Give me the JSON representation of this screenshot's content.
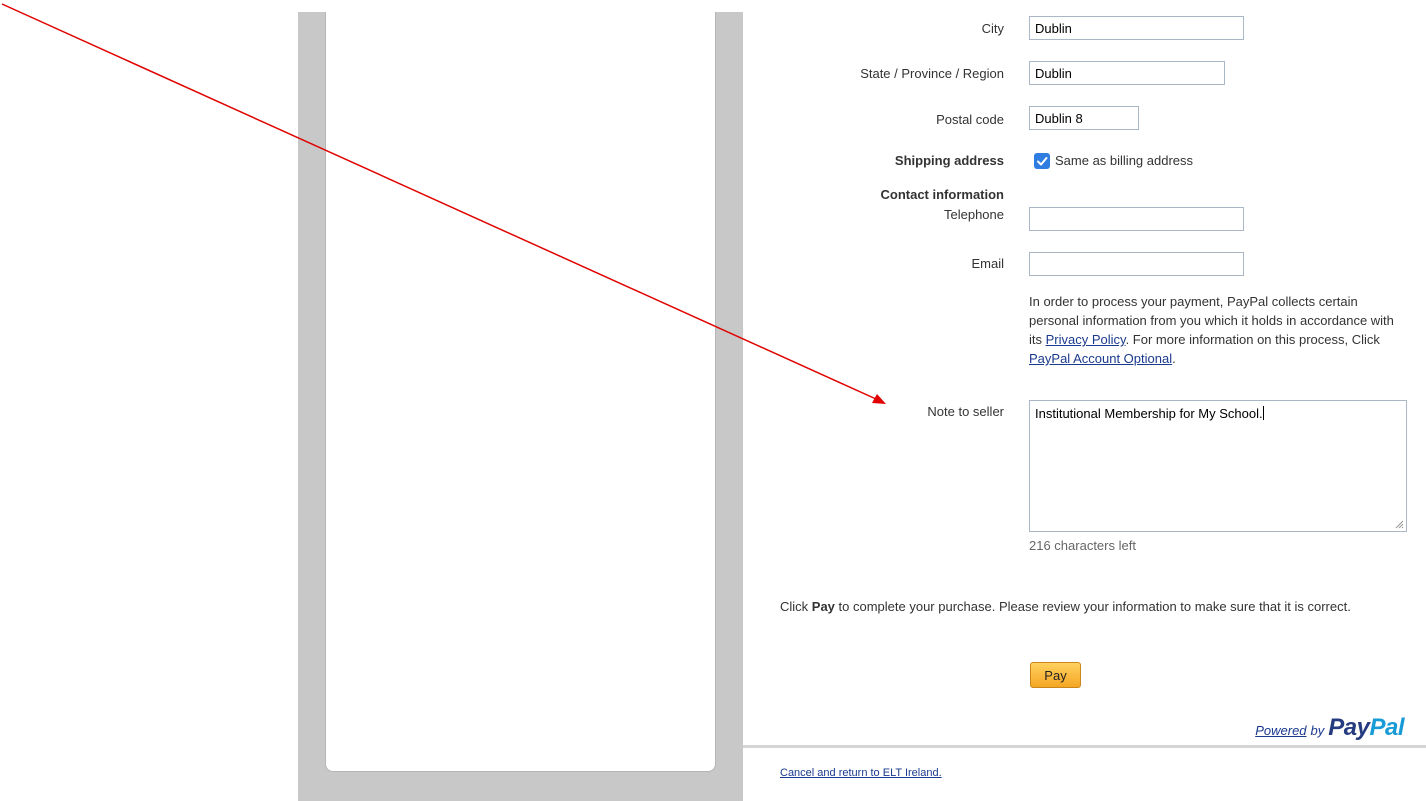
{
  "form": {
    "city": {
      "label": "City",
      "value": "Dublin"
    },
    "state": {
      "label": "State / Province / Region",
      "value": "Dublin"
    },
    "postal": {
      "label": "Postal code",
      "value": "Dublin 8"
    },
    "shipping": {
      "label": "Shipping address",
      "checkbox_label": "Same as billing address",
      "checked": true
    },
    "contact": {
      "heading": "Contact information",
      "telephone_label": "Telephone",
      "telephone_value": "",
      "email_label": "Email",
      "email_value": ""
    },
    "privacy": {
      "text_before": "In order to process your payment, PayPal collects certain personal information from you which it holds in accordance with its ",
      "privacy_link": "Privacy Policy",
      "text_middle": ". For more information on this process, Click ",
      "account_link": "PayPal Account Optional",
      "text_after": "."
    },
    "note": {
      "label": "Note to seller",
      "value": "Institutional Membership for My School.",
      "chars_left": "216 characters left"
    }
  },
  "pay_instruction": {
    "before": "Click ",
    "bold": "Pay",
    "after": " to complete your purchase. Please review your information to make sure that it is correct."
  },
  "pay_button": "Pay",
  "powered": {
    "powered": "Powered",
    "by": "by",
    "brand_a": "Pay",
    "brand_b": "Pal"
  },
  "cancel_link": "Cancel and return to ELT Ireland.",
  "colors": {
    "annotation_arrow": "#e00000",
    "link": "#1a3a8e",
    "checkbox": "#2f7de1",
    "pay_button": "#f5a623"
  }
}
